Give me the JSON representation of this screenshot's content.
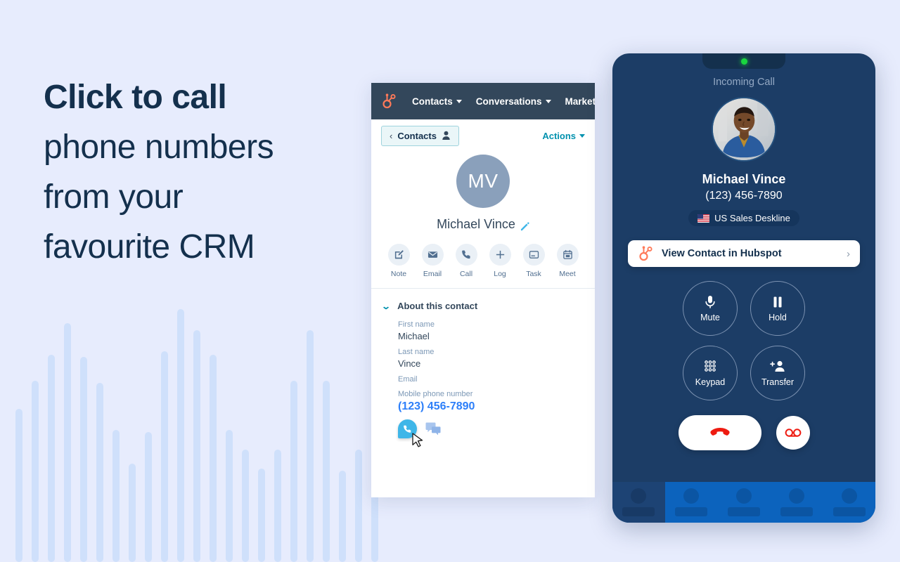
{
  "background_color": "#e7ecfd",
  "headline": {
    "lines": [
      {
        "text": "Click to call",
        "weight": "bold"
      },
      {
        "text": "phone numbers",
        "weight": "regular"
      },
      {
        "text": "from your",
        "weight": "regular"
      },
      {
        "text": "favourite CRM",
        "weight": "regular"
      }
    ]
  },
  "waveform": {
    "bar_color": "#cfe0fb",
    "heights": [
      218,
      258,
      295,
      340,
      292,
      255,
      188,
      140,
      185,
      300,
      360,
      330,
      295,
      188,
      160,
      133,
      160,
      258,
      330,
      258,
      130,
      160,
      255
    ]
  },
  "crm": {
    "brand": "hubspot-logo",
    "nav_items": [
      {
        "label": "Contacts",
        "has_dropdown": true
      },
      {
        "label": "Conversations",
        "has_dropdown": true
      },
      {
        "label": "Marketing",
        "has_dropdown": true
      }
    ],
    "back_button": {
      "chevron": "‹",
      "label": "Contacts"
    },
    "actions_menu": "Actions",
    "contact": {
      "initials": "MV",
      "name": "Michael Vince"
    },
    "quick_actions": [
      {
        "label": "Note",
        "icon": "note-icon"
      },
      {
        "label": "Email",
        "icon": "email-icon"
      },
      {
        "label": "Call",
        "icon": "call-icon"
      },
      {
        "label": "Log",
        "icon": "plus-icon"
      },
      {
        "label": "Task",
        "icon": "task-icon"
      },
      {
        "label": "Meet",
        "icon": "calendar-icon"
      }
    ],
    "about": {
      "section_title": "About this contact",
      "fields": [
        {
          "label": "First name",
          "value": "Michael"
        },
        {
          "label": "Last name",
          "value": "Vince"
        },
        {
          "label": "Email",
          "value": ""
        },
        {
          "label": "Mobile phone number",
          "value": "(123) 456-7890",
          "style": "phone-link"
        }
      ]
    },
    "phone_link_color": "#2d7ff9"
  },
  "phone": {
    "body_color": "#1c3d66",
    "led_color": "#19d63f",
    "status": "Incoming Call",
    "caller": {
      "name": "Michael Vince",
      "number": "(123) 456-7890",
      "line_badge": "US Sales Deskline",
      "flag": "us-flag-icon"
    },
    "view_contact_button": {
      "label": "View Contact in Hubspot",
      "brand_icon": "hubspot-logo",
      "chevron": "›"
    },
    "controls": [
      {
        "label": "Mute",
        "icon": "microphone-icon"
      },
      {
        "label": "Hold",
        "icon": "pause-icon"
      },
      {
        "label": "Keypad",
        "icon": "keypad-icon"
      },
      {
        "label": "Transfer",
        "icon": "transfer-user-icon"
      }
    ],
    "bottom_actions": [
      {
        "name": "hangup",
        "icon": "hangup-phone-icon",
        "color": "#ee1b11"
      },
      {
        "name": "voicemail",
        "icon": "voicemail-icon",
        "color": "#ee1b11"
      }
    ],
    "footer": {
      "cells": 5,
      "active_index": 0,
      "bar_color": "#0c63bd"
    }
  }
}
